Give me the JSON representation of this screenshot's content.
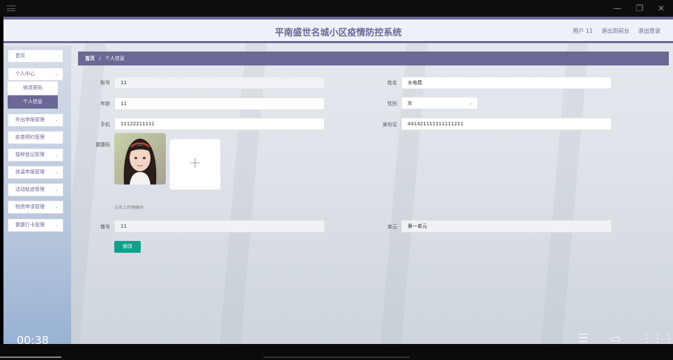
{
  "window": {
    "minimize_glyph": "—",
    "restore_glyph": "❐",
    "close_glyph": "✕"
  },
  "header": {
    "title": "平南盛世名城小区疫情防控系统",
    "user": "用户 11",
    "to_backend": "退出到前台",
    "logout": "退出登录"
  },
  "sidebar": {
    "home": "首页",
    "personal_center": "个人中心",
    "sub_items": [
      "修改密码",
      "个人信息"
    ],
    "items": [
      "外出申报管理",
      "疫苗预约管理",
      "接种登记管理",
      "体温申报管理",
      "活动轨迹管理",
      "物资申请管理",
      "健康打卡管理"
    ],
    "chevron": "⌄"
  },
  "breadcrumb": {
    "home": "首页",
    "sep": "/",
    "current": "个人信息"
  },
  "form": {
    "account_label": "账号",
    "account_value": "11",
    "name_label": "姓名",
    "name_value": "水电费",
    "age_label": "年龄",
    "age_value": "11",
    "gender_label": "性别",
    "gender_value": "女",
    "phone_label": "手机",
    "phone_value": "11122211111",
    "idcard_label": "身份证",
    "idcard_value": "441421111111111211",
    "health_code_label": "健康码",
    "upload_plus": "+",
    "upload_hint": "点击上传健康码",
    "building_label": "楼号",
    "building_value": "11",
    "unit_label": "单元",
    "unit_value": "第一单元",
    "submit_label": "修改"
  },
  "player": {
    "time": "00:38"
  }
}
